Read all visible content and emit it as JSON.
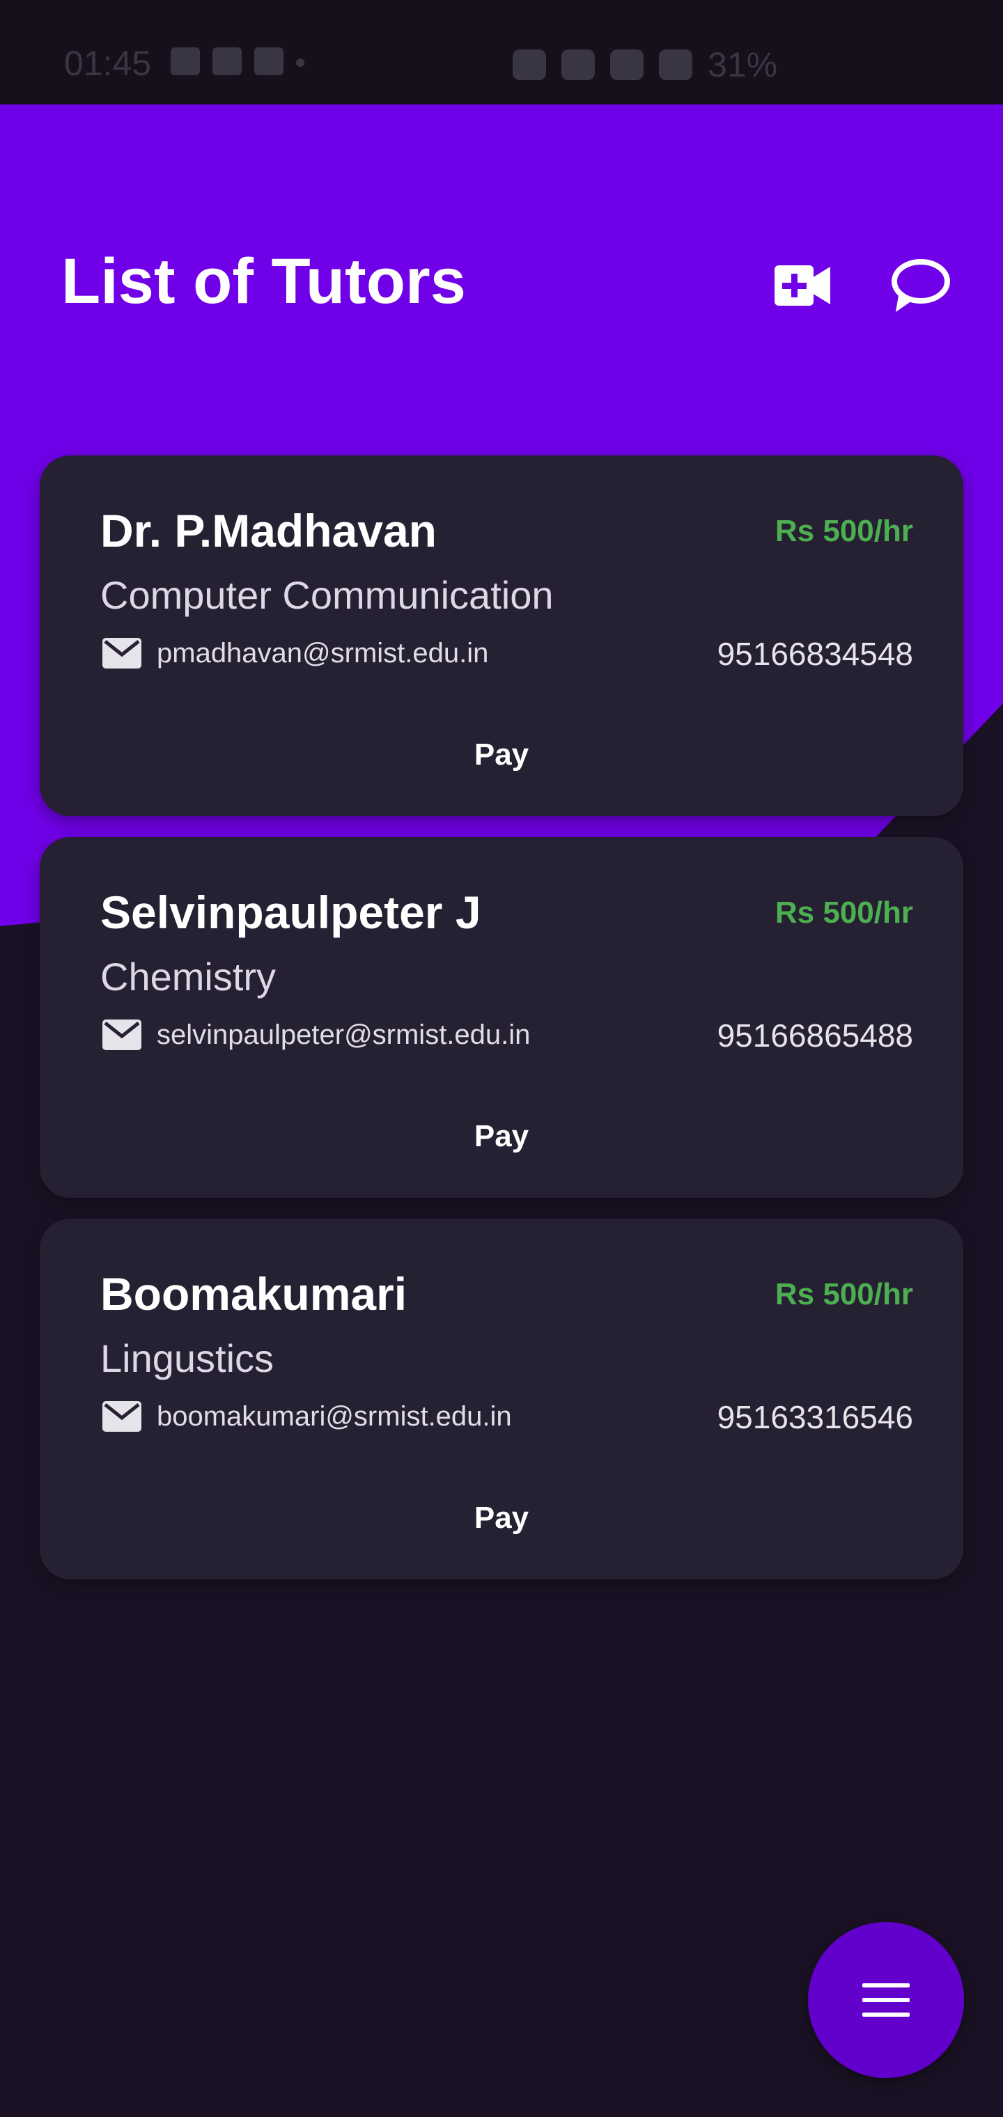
{
  "status_bar": {
    "time": "01:45",
    "battery": "31%",
    "icons": [
      "image-icon",
      "message-icon",
      "instagram-icon",
      "dot-icon",
      "alarm-icon",
      "hotspot-icon",
      "volte-icon",
      "signal-icon",
      "battery-icon"
    ]
  },
  "header": {
    "title": "List of Tutors",
    "actions": [
      "video-call-icon",
      "chat-icon"
    ]
  },
  "tutors": [
    {
      "name": "Dr. P.Madhavan",
      "rate": "Rs 500/hr",
      "subject": "Computer Communication",
      "email": "pmadhavan@srmist.edu.in",
      "phone": "95166834548",
      "pay_label": "Pay"
    },
    {
      "name": "Selvinpaulpeter J",
      "rate": "Rs 500/hr",
      "subject": "Chemistry",
      "email": "selvinpaulpeter@srmist.edu.in",
      "phone": "95166865488",
      "pay_label": "Pay"
    },
    {
      "name": "Boomakumari",
      "rate": "Rs 500/hr",
      "subject": "Lingustics",
      "email": "boomakumari@srmist.edu.in",
      "phone": "95163316546",
      "pay_label": "Pay"
    }
  ],
  "fab": {
    "icon": "menu-icon"
  },
  "colors": {
    "accent": "#7000e8",
    "background": "#1a1224",
    "card": "#262033",
    "rate": "#4caf50",
    "fab": "#6200cc"
  }
}
